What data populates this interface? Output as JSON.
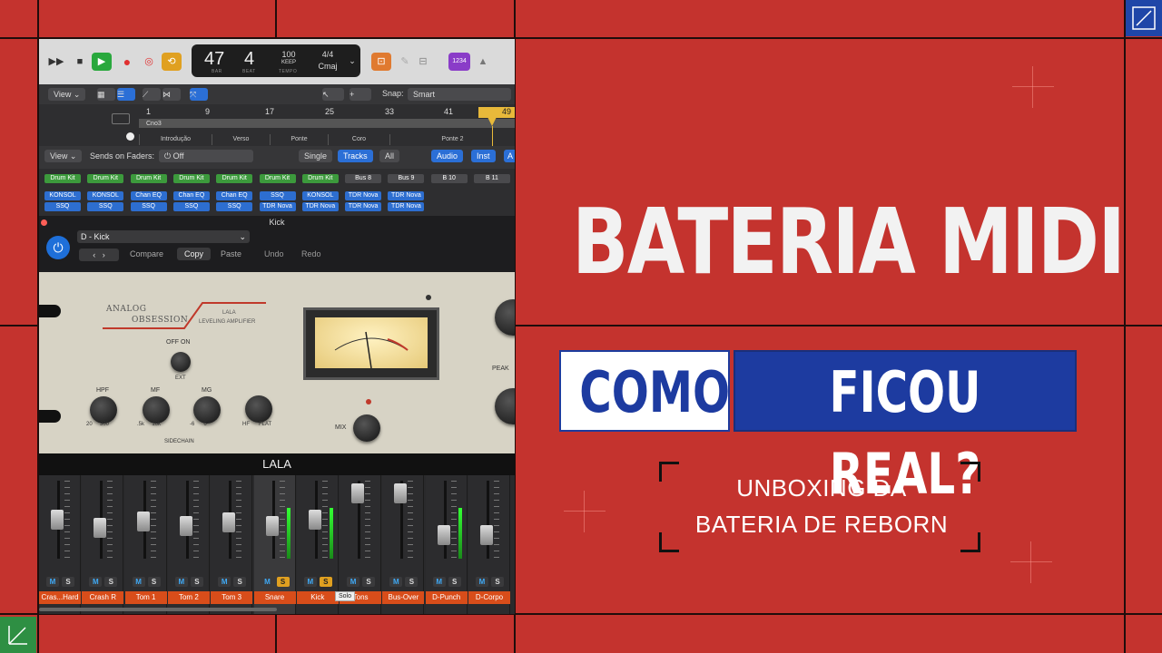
{
  "transport": {
    "bar": "47",
    "beat": "4",
    "bar_label": "BAR",
    "beat_label": "BEAT",
    "tempo": "100",
    "tempo_mode": "KEEP",
    "tempo_label": "TEMPO",
    "signature": "4/4",
    "key": "Cmaj",
    "count_in": "1234"
  },
  "toolbar": {
    "view_label": "View",
    "snap_label": "Snap:",
    "snap_value": "Smart"
  },
  "ruler": {
    "bars": [
      "1",
      "9",
      "17",
      "25",
      "33",
      "41",
      "49"
    ],
    "marker": "Cno3",
    "sections": [
      "Introdução",
      "Verso",
      "Ponte",
      "Coro",
      "Ponte 2"
    ]
  },
  "mixer_header": {
    "view_label": "View",
    "sends_label": "Sends on Faders:",
    "sends_value": "Off",
    "single": "Single",
    "tracks": "Tracks",
    "all": "All",
    "audio": "Audio",
    "inst": "Inst",
    "a": "A"
  },
  "slots": [
    {
      "a": "Drum Kit",
      "b": "KONSOL",
      "c": "SSQ"
    },
    {
      "a": "Drum Kit",
      "b": "KONSOL",
      "c": "SSQ"
    },
    {
      "a": "Drum Kit",
      "b": "Chan EQ",
      "c": "SSQ"
    },
    {
      "a": "Drum Kit",
      "b": "Chan EQ",
      "c": "SSQ"
    },
    {
      "a": "Drum Kit",
      "b": "Chan EQ",
      "c": "SSQ"
    },
    {
      "a": "Drum Kit",
      "b": "SSQ",
      "c": "TDR Nova"
    },
    {
      "a": "Drum Kit",
      "b": "KONSOL",
      "c": "TDR Nova"
    },
    {
      "a": "Bus 8",
      "b": "TDR Nova",
      "c": "TDR Nova"
    },
    {
      "a": "Bus 9",
      "b": "TDR Nova",
      "c": "TDR Nova"
    },
    {
      "a": "B 10",
      "b": "",
      "c": ""
    },
    {
      "a": "B 11",
      "b": "",
      "c": ""
    }
  ],
  "plugin": {
    "window_title": "Kick",
    "preset": "D - Kick",
    "compare": "Compare",
    "copy": "Copy",
    "paste": "Paste",
    "undo": "Undo",
    "redo": "Redo",
    "brand_line1": "ANALOG",
    "brand_line2": "OBSESSION",
    "model_line1": "LALA",
    "model_line2": "LEVELING AMPLIFIER",
    "off_on": "OFF  ON",
    "ext": "EXT",
    "hpf": "HPF",
    "mf": "MF",
    "mg": "MG",
    "hpf_range": "20     300",
    "mf_range": ".5k     16k",
    "mg_range": "-6      6",
    "hf_flat": "HF      FLAT",
    "sidechain": "SIDECHAIN",
    "mix": "MIX",
    "peak": "PEAK",
    "name_bar": "LALA"
  },
  "channels": [
    {
      "name": "Cras...Hard",
      "m": "M",
      "s": "S",
      "solo": false,
      "level": 0.55
    },
    {
      "name": "Crash R",
      "m": "M",
      "s": "S",
      "solo": false,
      "level": 0.42
    },
    {
      "name": "Tom 1",
      "m": "M",
      "s": "S",
      "solo": false,
      "level": 0.52
    },
    {
      "name": "Tom 2",
      "m": "M",
      "s": "S",
      "solo": false,
      "level": 0.45
    },
    {
      "name": "Tom 3",
      "m": "M",
      "s": "S",
      "solo": false,
      "level": 0.5
    },
    {
      "name": "Snare",
      "m": "M",
      "s": "S",
      "solo": true,
      "level": 0.44
    },
    {
      "name": "Kick",
      "m": "M",
      "s": "S",
      "solo": true,
      "level": 0.55
    },
    {
      "name": "Tons",
      "m": "M",
      "s": "S",
      "solo": false,
      "level": 0.96
    },
    {
      "name": "Bus-Over",
      "m": "M",
      "s": "S",
      "solo": false,
      "level": 0.96
    },
    {
      "name": "D-Punch",
      "m": "M",
      "s": "S",
      "solo": false,
      "level": 0.3
    },
    {
      "name": "D-Corpo",
      "m": "M",
      "s": "S",
      "solo": false,
      "level": 0.3
    }
  ],
  "tooltip": "Solo",
  "headline": {
    "title": "BATERIA MIDI",
    "como": "COMO",
    "ficou": "FICOU REAL?",
    "sub_line1": "UNBOXING DA",
    "sub_line2": "BATERIA DE REBORN"
  },
  "colors": {
    "background": "#c4332e",
    "blue": "#1d3ba0",
    "green_corner": "#2e8f43",
    "channel_name": "#d84d1a"
  }
}
